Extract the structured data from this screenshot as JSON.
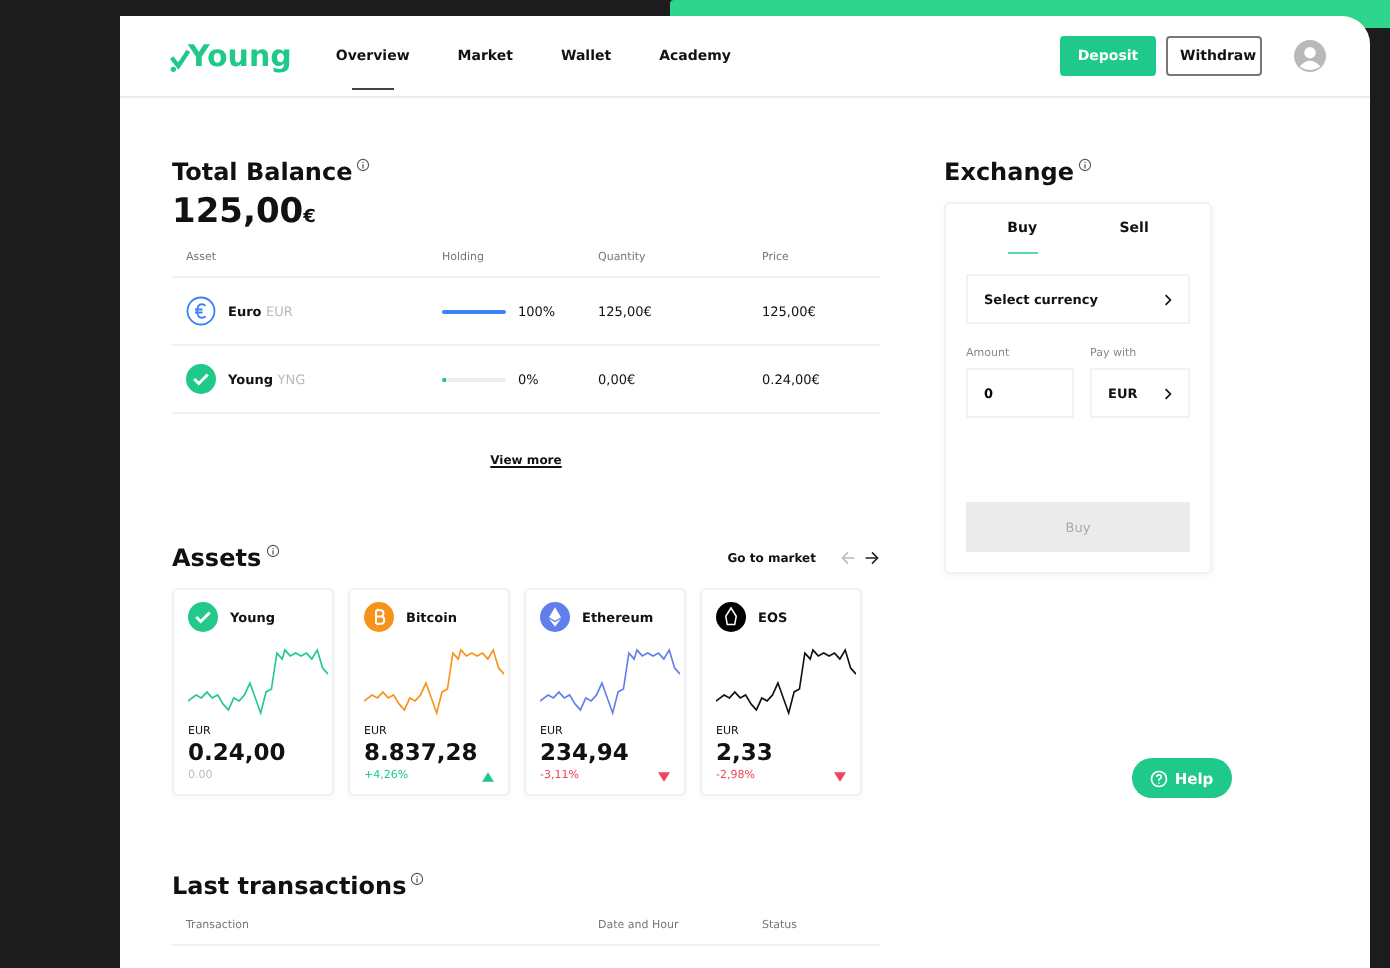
{
  "nav": {
    "logo": "Young",
    "links": [
      {
        "label": "Overview",
        "selected": true
      },
      {
        "label": "Market",
        "selected": false
      },
      {
        "label": "Wallet",
        "selected": false
      },
      {
        "label": "Academy",
        "selected": false
      }
    ],
    "deposit": "Deposit",
    "withdraw": "Withdraw"
  },
  "balance": {
    "title": "Total Balance",
    "amount": "125,00",
    "currency": "€"
  },
  "holdings": {
    "columns": [
      "Asset",
      "Holding",
      "Quantity",
      "Price"
    ],
    "rows": [
      {
        "name": "Euro",
        "code": "EUR",
        "level": 1.0,
        "percent": "100%",
        "quantity": "125,00€",
        "price": "125,00€",
        "color": "#3b82f6"
      },
      {
        "name": "Young",
        "code": "YNG",
        "level": 0.02,
        "percent": "0%",
        "quantity": "0,00€",
        "price": "0.24,00€",
        "color": "#1fc98a"
      }
    ],
    "view_more": "View more"
  },
  "assets": {
    "title": "Assets",
    "go_to_market": "Go to market",
    "cards": [
      {
        "name": "Young",
        "color": "#22c98a",
        "currency": "EUR",
        "value": "0.24,00",
        "change": "0.00",
        "kind": "flat"
      },
      {
        "name": "Bitcoin",
        "color": "#f7931a",
        "currency": "EUR",
        "value": "8.837,28",
        "change": "+4,26%",
        "kind": "up"
      },
      {
        "name": "Ethereum",
        "color": "#627eea",
        "currency": "EUR",
        "value": "234,94",
        "change": "-3,11%",
        "kind": "down"
      },
      {
        "name": "EOS",
        "color": "#111111",
        "currency": "EUR",
        "value": "2,33",
        "change": "-2,98%",
        "kind": "down"
      }
    ]
  },
  "transactions": {
    "title": "Last transactions",
    "columns": [
      "Transaction",
      "Date and Hour",
      "Status"
    ]
  },
  "exchange": {
    "title": "Exchange",
    "tabs": [
      {
        "label": "Buy",
        "selected": true
      },
      {
        "label": "Sell",
        "selected": false
      }
    ],
    "select_currency": "Select currency",
    "amount_label": "Amount",
    "amount": "0",
    "pay_label": "Pay with",
    "pay": "EUR",
    "submit": "Buy",
    "submit_disabled": true
  },
  "help": "Help"
}
